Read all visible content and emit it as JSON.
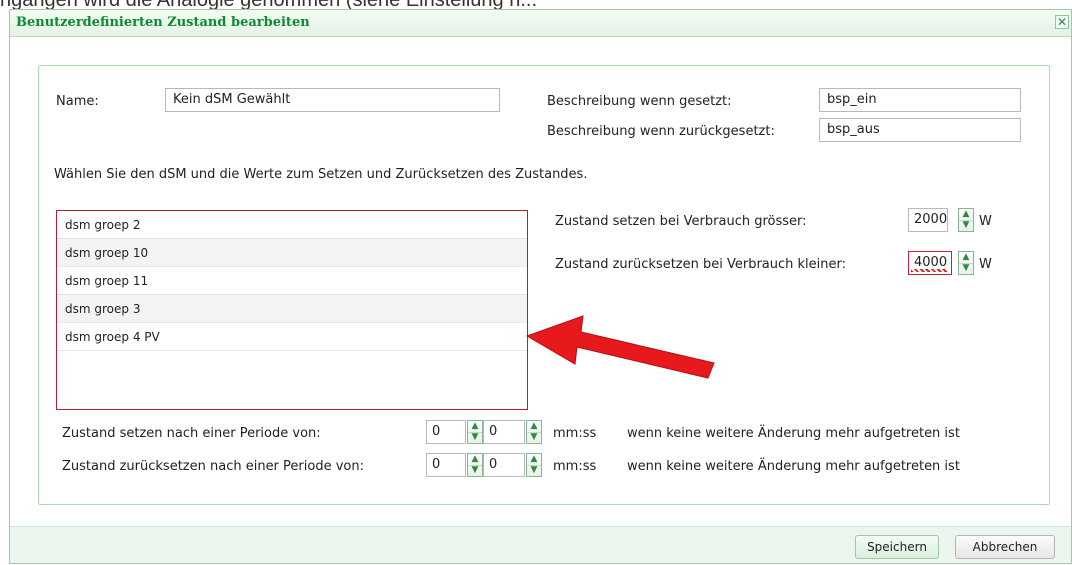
{
  "background_fragment": "ngangen wird die Analogie genommen (siehe Einsteilung n...",
  "dialog": {
    "title": "Benutzerdefinierten Zustand bearbeiten",
    "close_glyph": "✕"
  },
  "form": {
    "name_label": "Name:",
    "name_value": "Kein dSM Gewählt",
    "desc_set_label": "Beschreibung wenn gesetzt:",
    "desc_set_value": "bsp_ein",
    "desc_reset_label": "Beschreibung wenn zurückgesetzt:",
    "desc_reset_value": "bsp_aus",
    "instruction": "Wählen Sie den dSM und die Werte zum Setzen und Zurücksetzen des Zustandes."
  },
  "dsm_list": [
    "dsm groep 2",
    "dsm groep 10",
    "dsm groep 11",
    "dsm groep 3",
    "dsm groep 4 PV"
  ],
  "consumption": {
    "set_label": "Zustand setzen bei Verbrauch grösser:",
    "set_value": "2000",
    "reset_label": "Zustand zurücksetzen bei Verbrauch kleiner:",
    "reset_value": "4000",
    "unit": "W"
  },
  "periods": {
    "set_label": "Zustand setzen nach einer Periode von:",
    "set_minutes": "0",
    "set_seconds": "0",
    "reset_label": "Zustand zurücksetzen nach einer Periode von:",
    "reset_minutes": "0",
    "reset_seconds": "0",
    "unit": "mm:ss",
    "condition": "wenn keine weitere Änderung mehr aufgetreten ist"
  },
  "buttons": {
    "save": "Speichern",
    "cancel": "Abbrechen"
  },
  "colors": {
    "accent_green": "#0f8a2e",
    "error_red": "#cc1f3a",
    "annotation_arrow": "#e8191c"
  }
}
